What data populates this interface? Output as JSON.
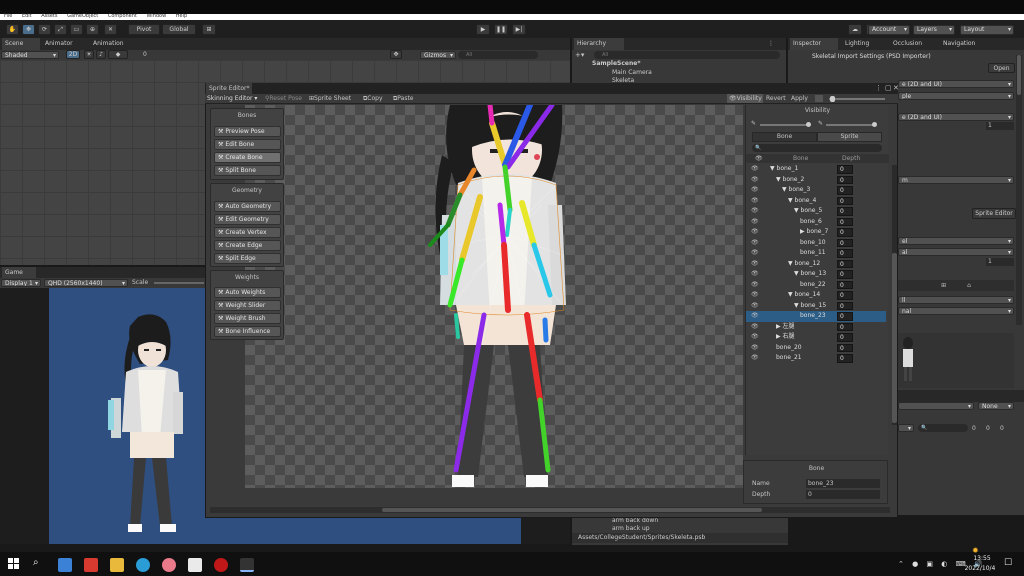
{
  "menubar": {
    "items": [
      "File",
      "Edit",
      "Assets",
      "GameObject",
      "Component",
      "Window",
      "Help"
    ]
  },
  "toolbar": {
    "pivot": "Pivot",
    "global": "Global",
    "account": "Account",
    "layers": "Layers",
    "layout": "Layout"
  },
  "scene": {
    "tabs": [
      "Scene",
      "Animator",
      "Animation"
    ],
    "shading": "Shaded",
    "mode2d": "2D",
    "gizmos": "Gizmos",
    "search_placeholder": "All",
    "toggle_count": "0"
  },
  "game": {
    "tab": "Game",
    "display": "Display 1",
    "resolution": "QHD (2560x1440)",
    "scale": "Scale"
  },
  "hierarchy": {
    "tab": "Hierarchy",
    "search_placeholder": "All",
    "items": [
      "SampleScene*",
      "Main Camera",
      "Skeleta"
    ]
  },
  "inspector": {
    "tabs": [
      "Inspector",
      "Lighting",
      "Occlusion",
      "Navigation"
    ],
    "title": "Skeletal Import Settings (PSD Importer)",
    "open": "Open",
    "field_a": "e (2D and UI)",
    "field_b": "ple",
    "field_c": "m",
    "sprite_editor": "Sprite Editor",
    "field_d": "el",
    "field_e": "al",
    "field_f": "ll",
    "field_g": "nal",
    "num_a": "1",
    "num_b": "1",
    "none": "None",
    "search_placeholder": "",
    "counts": [
      "0",
      "0",
      "0"
    ]
  },
  "project": {
    "items": [
      "arm back down",
      "arm back up"
    ],
    "path": "Assets/CollegeStudent/Sprites/Skeleta.psb"
  },
  "sprite_editor": {
    "title": "Sprite Editor*",
    "mode": "Skinning Editor",
    "reset_pose": "Reset Pose",
    "sprite_sheet": "Sprite Sheet",
    "copy": "Copy",
    "paste": "Paste",
    "visibility": "Visibility",
    "revert": "Revert",
    "apply": "Apply",
    "tool_groups": [
      {
        "title": "Bones",
        "tools": [
          "Preview Pose",
          "Edit Bone",
          "Create Bone",
          "Split Bone"
        ]
      },
      {
        "title": "Geometry",
        "tools": [
          "Auto Geometry",
          "Edit Geometry",
          "Create Vertex",
          "Create Edge",
          "Split Edge"
        ]
      },
      {
        "title": "Weights",
        "tools": [
          "Auto Weights",
          "Weight Slider",
          "Weight Brush",
          "Bone Influence"
        ]
      }
    ],
    "selected_tool": "Create Bone"
  },
  "visibility_panel": {
    "title": "Visibility",
    "tab_bone": "Bone",
    "tab_sprite": "Sprite",
    "col_bone": "Bone",
    "col_depth": "Depth",
    "rows": [
      {
        "name": "bone_1",
        "depth": "0",
        "indent": 0,
        "arrow": "▼"
      },
      {
        "name": "bone_2",
        "depth": "0",
        "indent": 1,
        "arrow": "▼"
      },
      {
        "name": "bone_3",
        "depth": "0",
        "indent": 2,
        "arrow": "▼"
      },
      {
        "name": "bone_4",
        "depth": "0",
        "indent": 3,
        "arrow": "▼"
      },
      {
        "name": "bone_5",
        "depth": "0",
        "indent": 4,
        "arrow": "▼"
      },
      {
        "name": "bone_6",
        "depth": "0",
        "indent": 5,
        "arrow": ""
      },
      {
        "name": "bone_7",
        "depth": "0",
        "indent": 5,
        "arrow": "▶"
      },
      {
        "name": "bone_10",
        "depth": "0",
        "indent": 5,
        "arrow": ""
      },
      {
        "name": "bone_11",
        "depth": "0",
        "indent": 5,
        "arrow": ""
      },
      {
        "name": "bone_12",
        "depth": "0",
        "indent": 3,
        "arrow": "▼"
      },
      {
        "name": "bone_13",
        "depth": "0",
        "indent": 4,
        "arrow": "▼"
      },
      {
        "name": "bone_22",
        "depth": "0",
        "indent": 5,
        "arrow": ""
      },
      {
        "name": "bone_14",
        "depth": "0",
        "indent": 3,
        "arrow": "▼"
      },
      {
        "name": "bone_15",
        "depth": "0",
        "indent": 4,
        "arrow": "▼"
      },
      {
        "name": "bone_23",
        "depth": "0",
        "indent": 5,
        "arrow": ""
      },
      {
        "name": "左腿",
        "depth": "0",
        "indent": 1,
        "arrow": "▶"
      },
      {
        "name": "右腿",
        "depth": "0",
        "indent": 1,
        "arrow": "▶"
      },
      {
        "name": "bone_20",
        "depth": "0",
        "indent": 1,
        "arrow": ""
      },
      {
        "name": "bone_21",
        "depth": "0",
        "indent": 1,
        "arrow": ""
      }
    ],
    "selected_row": "bone_23"
  },
  "bone_inspector": {
    "title": "Bone",
    "name_label": "Name",
    "name_value": "bone_23",
    "depth_label": "Depth",
    "depth_value": "0"
  },
  "taskbar": {
    "time": "13:55",
    "date": "2022/10/4"
  },
  "colors": {
    "accent": "#2c5d87",
    "game_bg": "#2f4f80"
  }
}
